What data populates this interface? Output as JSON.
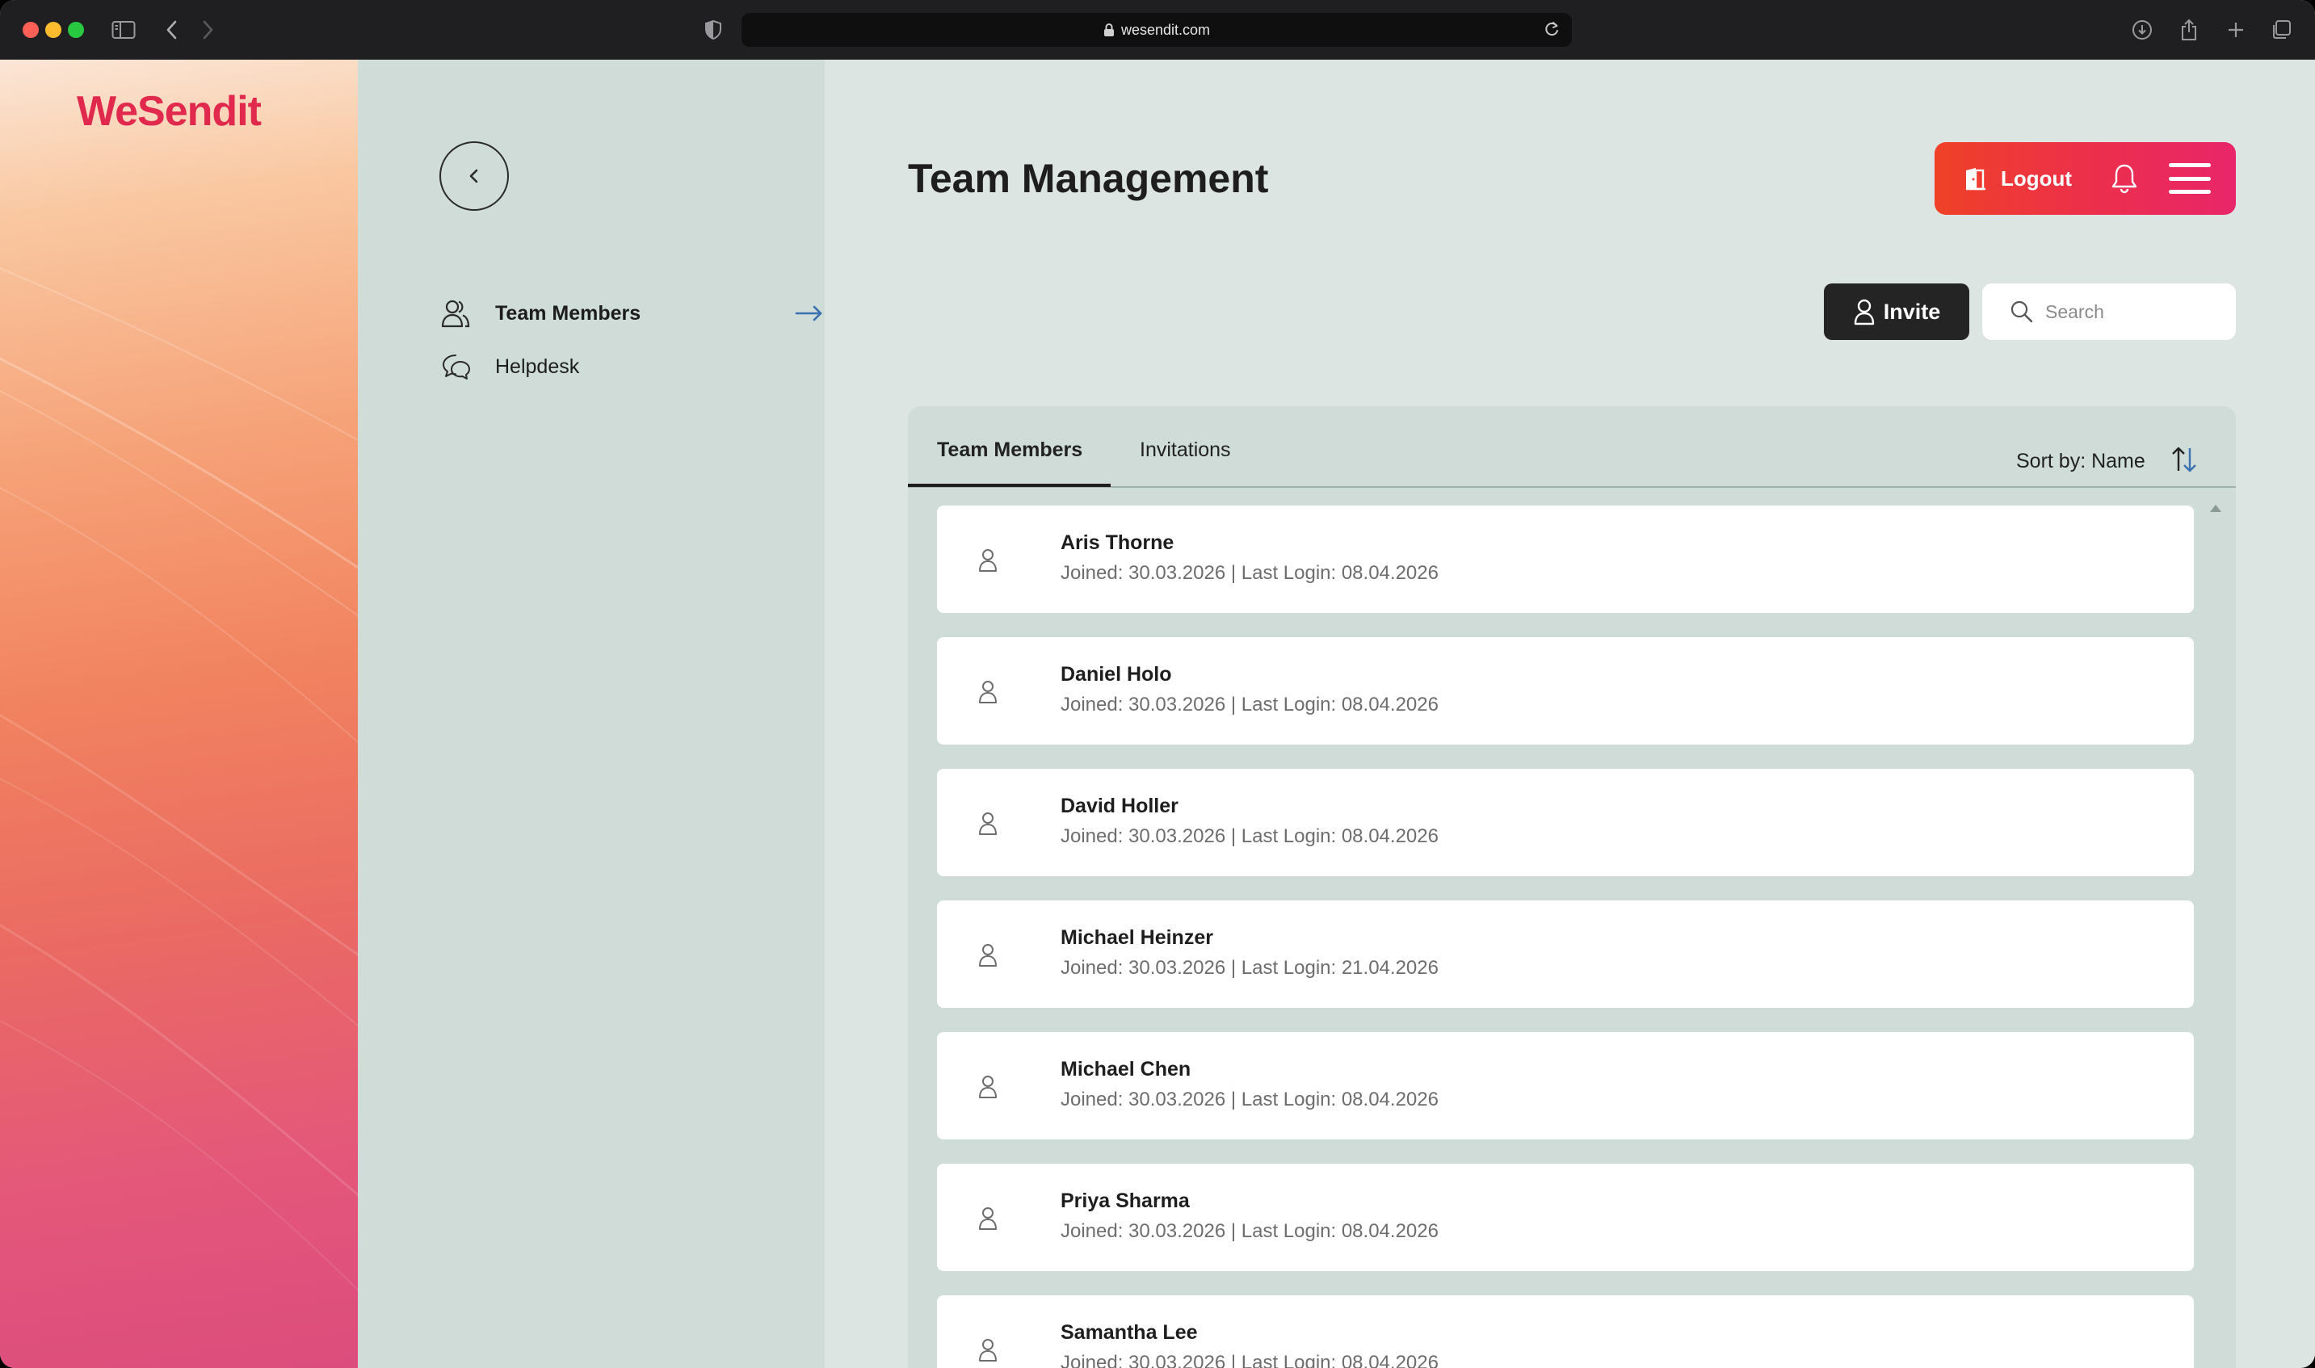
{
  "browser": {
    "url": "wesendit.com"
  },
  "brand": {
    "logo_text": "WeSendit",
    "accent_color": "#e1284d"
  },
  "sidebar": {
    "items": [
      {
        "label": "Team Members",
        "icon": "team-icon",
        "active": true
      },
      {
        "label": "Helpdesk",
        "icon": "chat-bubbles-icon",
        "active": false
      }
    ]
  },
  "header": {
    "title": "Team Management",
    "logout_label": "Logout"
  },
  "toolbar": {
    "invite_label": "Invite",
    "search_placeholder": "Search"
  },
  "tabs": [
    {
      "label": "Team Members",
      "active": true
    },
    {
      "label": "Invitations",
      "active": false
    }
  ],
  "sort": {
    "label": "Sort by: Name"
  },
  "members": [
    {
      "name": "Aris Thorne",
      "meta": "Joined: 30.03.2026 | Last Login: 08.04.2026"
    },
    {
      "name": "Daniel Holo",
      "meta": "Joined: 30.03.2026 | Last Login: 08.04.2026"
    },
    {
      "name": "David Holler",
      "meta": "Joined: 30.03.2026 | Last Login: 08.04.2026"
    },
    {
      "name": "Michael Heinzer",
      "meta": "Joined: 30.03.2026 | Last Login: 21.04.2026"
    },
    {
      "name": "Michael Chen",
      "meta": "Joined: 30.03.2026 | Last Login: 08.04.2026"
    },
    {
      "name": "Priya Sharma",
      "meta": "Joined: 30.03.2026 | Last Login: 08.04.2026"
    },
    {
      "name": "Samantha Lee",
      "meta": "Joined: 30.03.2026 | Last Login: 08.04.2026"
    }
  ]
}
